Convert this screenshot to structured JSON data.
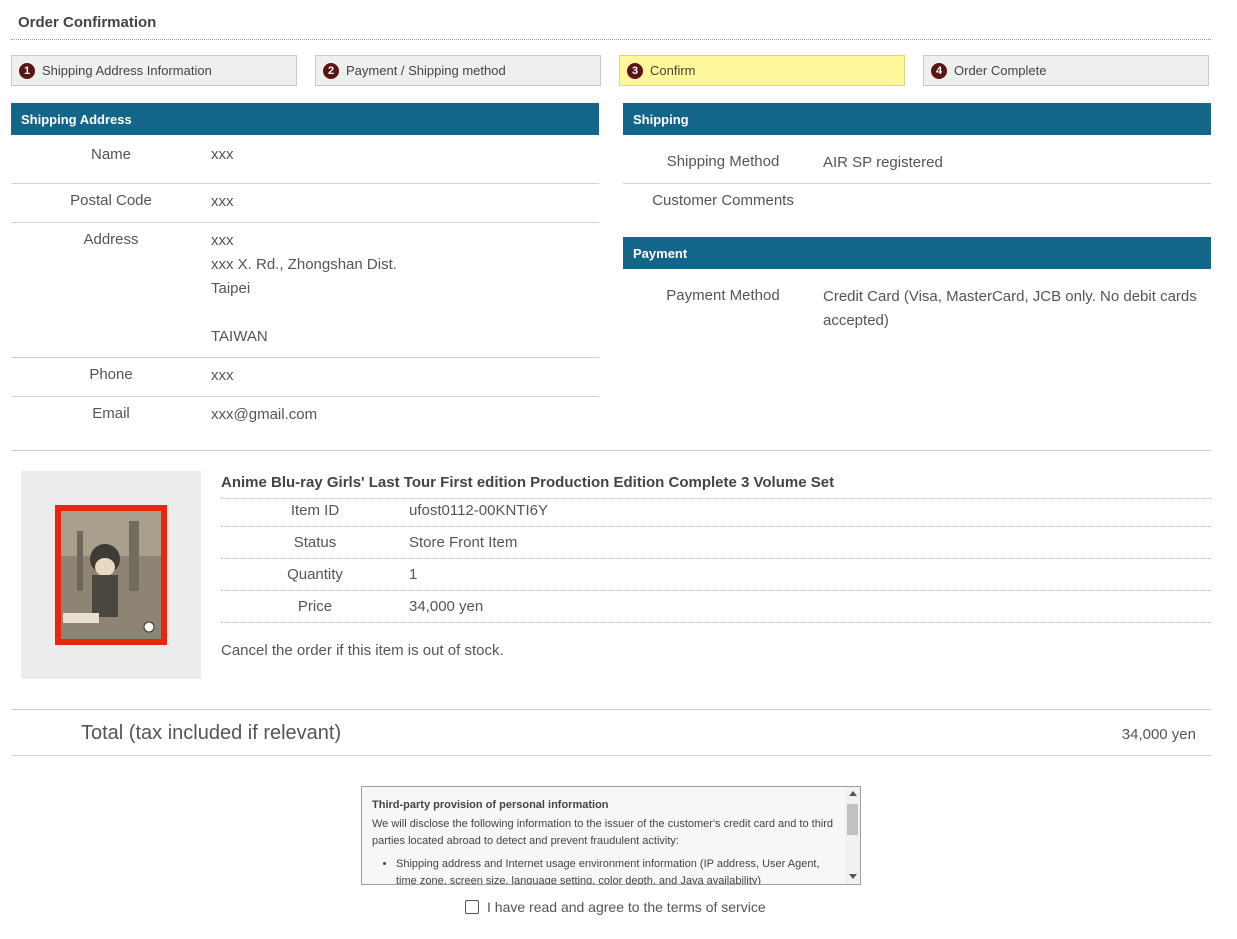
{
  "page": {
    "title": "Order Confirmation"
  },
  "steps": [
    {
      "num": "1",
      "label": "Shipping Address Information"
    },
    {
      "num": "2",
      "label": "Payment / Shipping method"
    },
    {
      "num": "3",
      "label": "Confirm"
    },
    {
      "num": "4",
      "label": "Order Complete"
    }
  ],
  "shipping_address": {
    "heading": "Shipping Address",
    "rows": [
      {
        "label": "Name",
        "value": "xxx"
      },
      {
        "label": "Postal Code",
        "value": "xxx"
      },
      {
        "label": "Address",
        "value": "xxx\nxxx X. Rd., Zhongshan Dist.\nTaipei\n\nTAIWAN"
      },
      {
        "label": "Phone",
        "value": "xxx"
      },
      {
        "label": "Email",
        "value": "xxx@gmail.com"
      }
    ]
  },
  "shipping": {
    "heading": "Shipping",
    "rows": [
      {
        "label": "Shipping Method",
        "value": "AIR SP registered"
      },
      {
        "label": "Customer Comments",
        "value": ""
      }
    ]
  },
  "payment": {
    "heading": "Payment",
    "rows": [
      {
        "label": "Payment Method",
        "value": "Credit Card (Visa, MasterCard, JCB only. No debit cards accepted)"
      }
    ]
  },
  "item": {
    "title": "Anime Blu-ray Girls' Last Tour First edition Production Edition Complete 3 Volume Set",
    "rows": [
      {
        "label": "Item ID",
        "value": "ufost0112-00KNTI6Y"
      },
      {
        "label": "Status",
        "value": "Store Front Item"
      },
      {
        "label": "Quantity",
        "value": "1"
      },
      {
        "label": "Price",
        "value": "34,000 yen"
      }
    ],
    "cancel_note": "Cancel the order if this item is out of stock."
  },
  "total": {
    "label": "Total (tax included if relevant)",
    "value": "34,000 yen"
  },
  "terms": {
    "heading": "Third-party provision of personal information",
    "body": "We will disclose the following information to the issuer of the customer's credit card and to third parties located abroad to detect and prevent fraudulent activity:",
    "bullet": "Shipping address and Internet usage environment information (IP address, User Agent, time zone, screen size, language setting, color depth, and Java availability)"
  },
  "agree": {
    "label": "I have read and agree to the terms of service"
  },
  "colors": {
    "header_bg": "#136689",
    "step_active_bg": "#fff799",
    "step_num_bg": "#5a1414"
  }
}
